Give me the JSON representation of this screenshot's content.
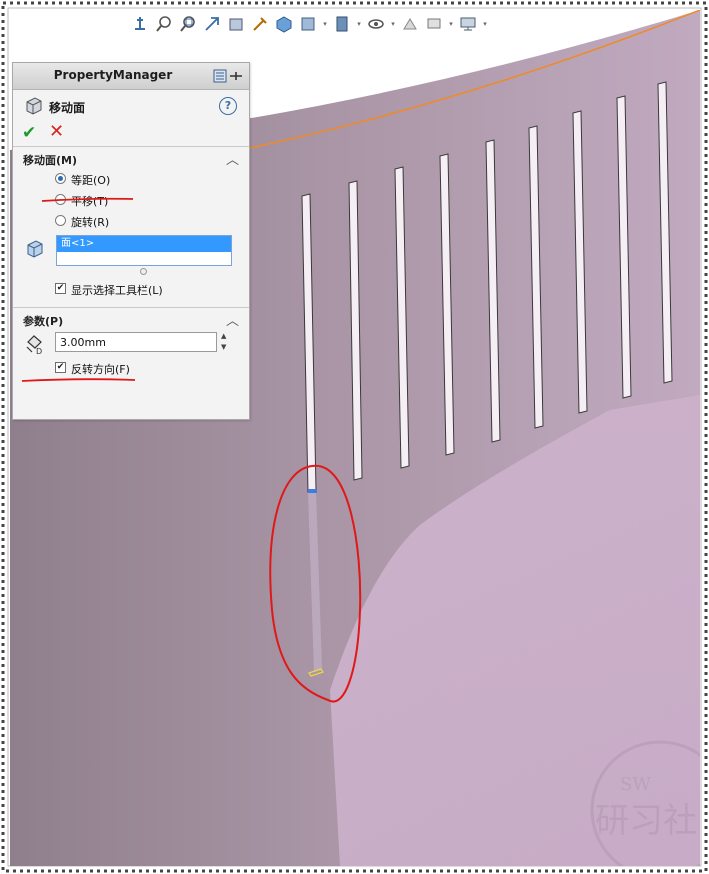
{
  "toolbar": {
    "icons": [
      "view-orientation-icon",
      "zoom-to-fit-icon",
      "zoom-area-icon",
      "previous-view-icon",
      "section-view-icon",
      "dynamic-annotation-icon",
      "view-orientation-cube-icon",
      "display-style-icon",
      "hide-show-icon",
      "edit-appearance-icon",
      "apply-scene-icon",
      "view-settings-icon"
    ]
  },
  "property_manager": {
    "title": "PropertyManager",
    "feature_name": "移动面",
    "help": "?",
    "ok": "✔",
    "cancel": "✕",
    "move_face_group": {
      "title": "移动面(M)",
      "options": [
        {
          "label": "等距(O)",
          "checked": true
        },
        {
          "label": "平移(T)",
          "checked": false
        },
        {
          "label": "旋转(R)",
          "checked": false
        }
      ],
      "selection_item": "面<1>",
      "show_toolbar_label": "显示选择工具栏(L)",
      "show_toolbar_checked": true
    },
    "params_group": {
      "title": "参数(P)",
      "distance_value": "3.00mm",
      "reverse_label": "反转方向(F)",
      "reverse_checked": true
    }
  },
  "watermark": {
    "line1": "SW",
    "line2": "研习社"
  },
  "colors": {
    "face": "#a990a2",
    "face_light": "#c6b0c4",
    "edge_highlight": "#f08a24",
    "annotation": "#e01818",
    "selected_face": "#3b7de0"
  }
}
